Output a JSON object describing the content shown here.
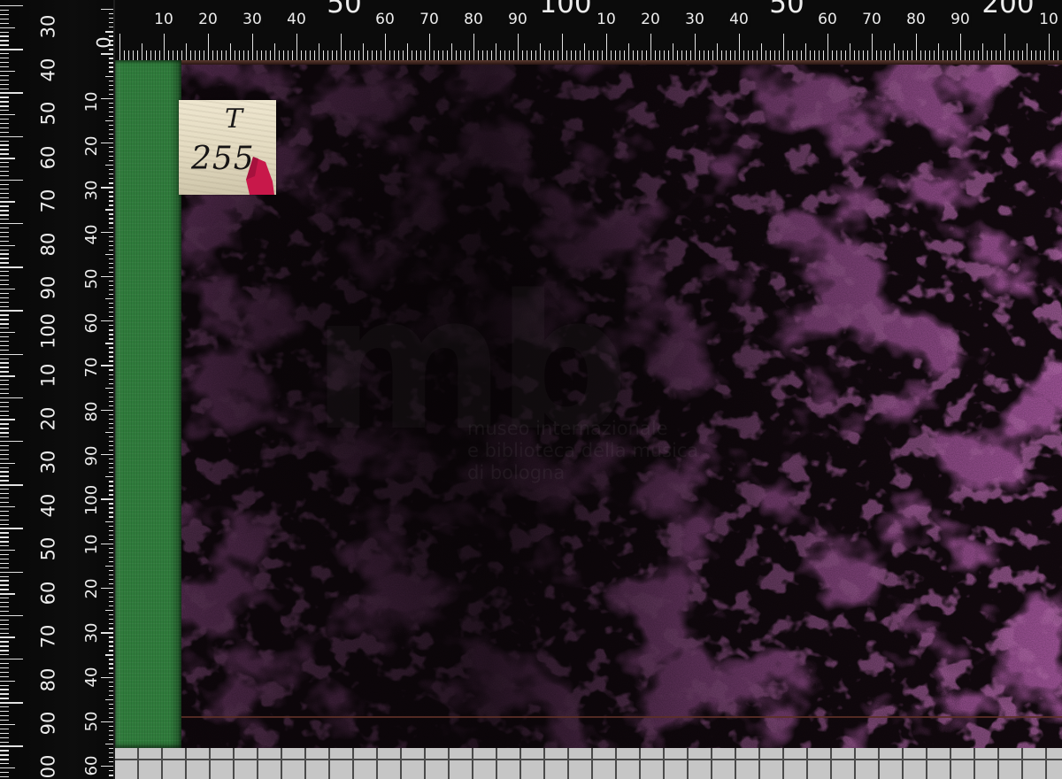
{
  "top_ruler": {
    "labels": [
      "0",
      "10",
      "20",
      "30",
      "40",
      "50",
      "60",
      "70",
      "80",
      "90",
      "100",
      "10",
      "20",
      "30",
      "40",
      "50",
      "60",
      "70",
      "80",
      "90",
      "200",
      "10"
    ]
  },
  "left_ruler": {
    "outer_labels": [
      "30",
      "40",
      "50",
      "60",
      "70",
      "80",
      "90",
      "100",
      "10",
      "20",
      "30",
      "40",
      "50",
      "60",
      "70",
      "80",
      "90",
      "00"
    ],
    "inner_labels": [
      "10",
      "20",
      "30",
      "40",
      "50",
      "60",
      "70",
      "80",
      "90",
      "100",
      "10",
      "20",
      "30",
      "40",
      "50",
      "60"
    ]
  },
  "shelf_label": {
    "line1": "T",
    "line2": "255"
  },
  "watermark": {
    "logo": "mb",
    "lines": [
      "museo internazionale",
      "e biblioteca della musica",
      "di bologna"
    ]
  },
  "colors": {
    "spine": "#2f7b3b",
    "cover_base": "#140a10",
    "marble": "#6b2a66",
    "ruler": "#0b0b0b",
    "ruler_marks": "#e2e2e2",
    "grid_strip": "#c6c6c6",
    "label_paper": "#e6dcc3",
    "label_mark": "#c8184a"
  }
}
